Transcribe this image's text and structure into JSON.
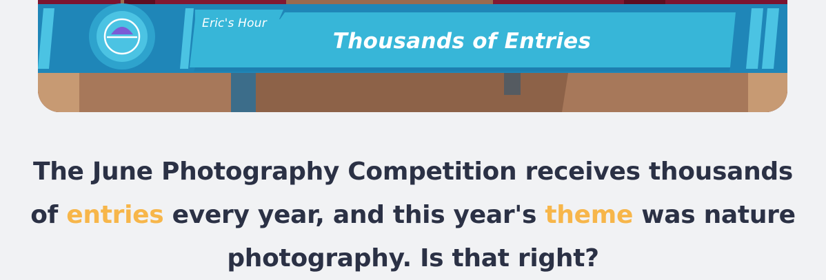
{
  "video": {
    "show_name": "Eric's Hour",
    "headline": "Thousands of Entries",
    "logo": "eric-hour-logo-icon"
  },
  "caption": {
    "part1": "The June Photography Competition receives thousands of ",
    "highlight1": "entries",
    "part2": " every year, and this year's ",
    "highlight2": "theme",
    "part3": " was nature photography. Is that right?"
  },
  "colors": {
    "background": "#f1f2f4",
    "banner_blue": "#37b6d8",
    "banner_dark": "#1f86b8",
    "caption_text": "#2b3145",
    "highlight": "#f7b64a"
  }
}
